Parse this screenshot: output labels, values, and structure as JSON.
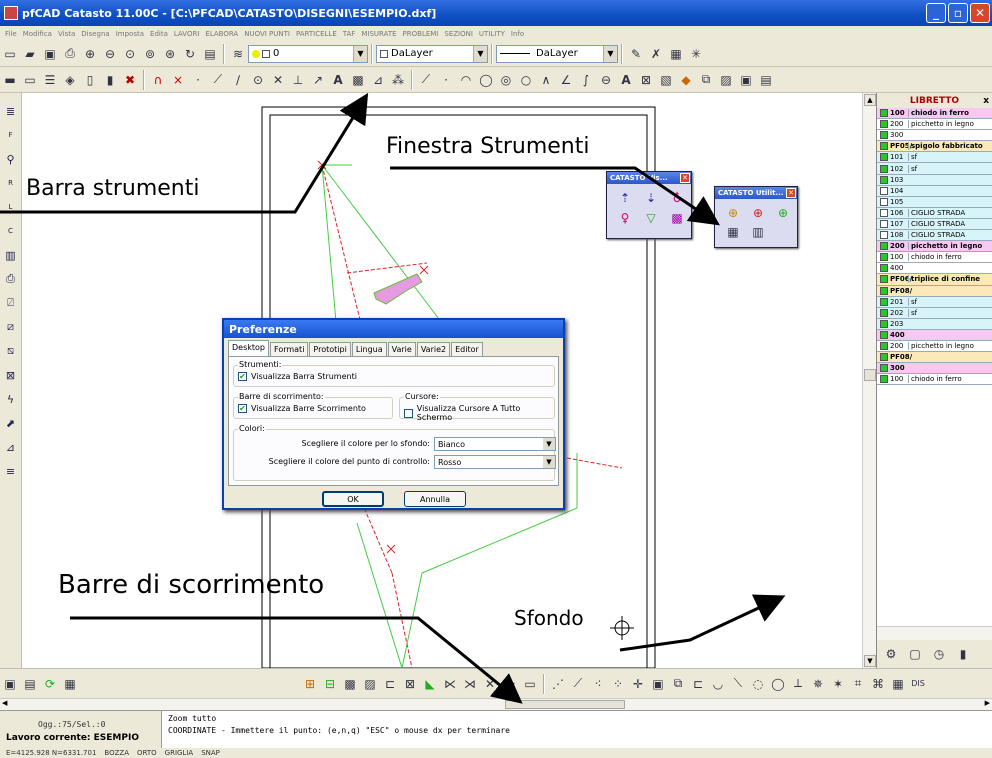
{
  "window": {
    "title": "pfCAD Catasto 11.00C - [C:\\PFCAD\\CATASTO\\DISEGNI\\ESEMPIO.dxf]",
    "min": "_",
    "max": "▫",
    "close": "✕"
  },
  "menu": [
    "File",
    "Modifica",
    "Vista",
    "Disegna",
    "Imposta",
    "Edita",
    "LAVORI",
    "ELABORA",
    "NUOVI PUNTI",
    "PARTICELLE",
    "TAF",
    "MISURATE",
    "PROBLEMI",
    "SEZIONI",
    "UTILITY",
    "Info"
  ],
  "toolbar": {
    "layer": "0",
    "color": "DaLayer",
    "linetype": "DaLayer"
  },
  "annotations": {
    "barra_strumenti": "Barra strumenti",
    "finestra_strumenti": "Finestra Strumenti",
    "barre_scorrimento": "Barre di scorrimento",
    "sfondo": "Sfondo"
  },
  "tool_windows": [
    {
      "title": "CATASTO Vis...",
      "close": "✕"
    },
    {
      "title": "CATASTO Utilit...",
      "close": "✕"
    }
  ],
  "libretto": {
    "title": "LIBRETTO",
    "close": "x",
    "rows": [
      {
        "pt": "100",
        "desc": "chiodo in ferro",
        "bg": "#f7c9f2",
        "bold": true,
        "check": "#2cc42c"
      },
      {
        "pt": "200",
        "desc": "picchetto in legno",
        "bg": "#ffffff",
        "bold": false,
        "check": "#2cc42c"
      },
      {
        "pt": "300",
        "desc": "",
        "bg": "#ffffff",
        "bold": false,
        "check": "#2cc42c"
      },
      {
        "pt": "PF05/",
        "desc": "spigolo fabbricato",
        "bg": "#fbe9b8",
        "bold": true,
        "check": "#2cc42c"
      },
      {
        "pt": "101",
        "desc": "sf",
        "bg": "#d7f4f9",
        "bold": false,
        "check": "#2cc42c"
      },
      {
        "pt": "102",
        "desc": "sf",
        "bg": "#d7f4f9",
        "bold": false,
        "check": "#2cc42c"
      },
      {
        "pt": "103",
        "desc": "",
        "bg": "#d7f4f9",
        "bold": false,
        "check": "#2cc42c"
      },
      {
        "pt": "104",
        "desc": "",
        "bg": "#d7f4f9",
        "bold": false,
        "check": "#ffffff"
      },
      {
        "pt": "105",
        "desc": "",
        "bg": "#d7f4f9",
        "bold": false,
        "check": "#ffffff"
      },
      {
        "pt": "106",
        "desc": "CIGLIO STRADA",
        "bg": "#d7f4f9",
        "bold": false,
        "check": "#ffffff"
      },
      {
        "pt": "107",
        "desc": "CIGLIO STRADA",
        "bg": "#d7f4f9",
        "bold": false,
        "check": "#ffffff"
      },
      {
        "pt": "108",
        "desc": "CIGLIO STRADA",
        "bg": "#d7f4f9",
        "bold": false,
        "check": "#ffffff"
      },
      {
        "pt": "200",
        "desc": "picchetto in legno",
        "bg": "#f7c9f2",
        "bold": true,
        "check": "#2cc42c"
      },
      {
        "pt": "100",
        "desc": "chiodo in ferro",
        "bg": "#ffffff",
        "bold": false,
        "check": "#2cc42c"
      },
      {
        "pt": "400",
        "desc": "",
        "bg": "#ffffff",
        "bold": false,
        "check": "#2cc42c"
      },
      {
        "pt": "PF06/",
        "desc": "triplice di confine",
        "bg": "#fbe9b8",
        "bold": true,
        "check": "#2cc42c"
      },
      {
        "pt": "PF08/",
        "desc": "",
        "bg": "#fbe9b8",
        "bold": true,
        "check": "#2cc42c"
      },
      {
        "pt": "201",
        "desc": "sf",
        "bg": "#d7f4f9",
        "bold": false,
        "check": "#2cc42c"
      },
      {
        "pt": "202",
        "desc": "sf",
        "bg": "#d7f4f9",
        "bold": false,
        "check": "#2cc42c"
      },
      {
        "pt": "203",
        "desc": "",
        "bg": "#d7f4f9",
        "bold": false,
        "check": "#2cc42c"
      },
      {
        "pt": "400",
        "desc": "",
        "bg": "#f7c9f2",
        "bold": true,
        "check": "#2cc42c"
      },
      {
        "pt": "200",
        "desc": "picchetto in legno",
        "bg": "#ffffff",
        "bold": false,
        "check": "#2cc42c"
      },
      {
        "pt": "PF08/",
        "desc": "",
        "bg": "#fbe9b8",
        "bold": true,
        "check": "#2cc42c"
      },
      {
        "pt": "300",
        "desc": "",
        "bg": "#f7c9f2",
        "bold": true,
        "check": "#2cc42c"
      },
      {
        "pt": "100",
        "desc": "chiodo in ferro",
        "bg": "#ffffff",
        "bold": false,
        "check": "#2cc42c"
      }
    ]
  },
  "dialog": {
    "title": "Preferenze",
    "tabs": [
      "Desktop",
      "Formati",
      "Prototipi",
      "Lingua",
      "Varie",
      "Varie2",
      "Editor"
    ],
    "strumenti": {
      "legend": "Strumenti:",
      "checkbox": "Visualizza Barra Strumenti",
      "checked": "✔"
    },
    "barre": {
      "legend": "Barre di scorrimento:",
      "checkbox": "Visualizza Barre Scorrimento",
      "checked": "✔"
    },
    "cursore": {
      "legend": "Cursore:",
      "checkbox": "Visualizza Cursore A Tutto Schermo",
      "checked": ""
    },
    "colori": {
      "legend": "Colori:",
      "sfondo_label": "Scegliere il colore per lo sfondo:",
      "sfondo_value": "Bianco",
      "punto_label": "Scegliere il colore del punto di controllo:",
      "punto_value": "Rosso"
    },
    "ok": "OK",
    "annulla": "Annulla"
  },
  "command": {
    "ogg": "Ogg.:75/Sel.:0",
    "lavoro": "Lavoro corrente: ESEMPIO",
    "line1": "Zoom tutto",
    "line2": "COORDINATE - Immettere il punto: (e,n,q) \"ESC\" o mouse dx per terminare"
  },
  "status": {
    "coords": "E=4125.928 N=6331.701",
    "bozza": "BOZZA",
    "orto": "ORTO",
    "griglia": "GRIGLIA",
    "snap": "SNAP"
  }
}
